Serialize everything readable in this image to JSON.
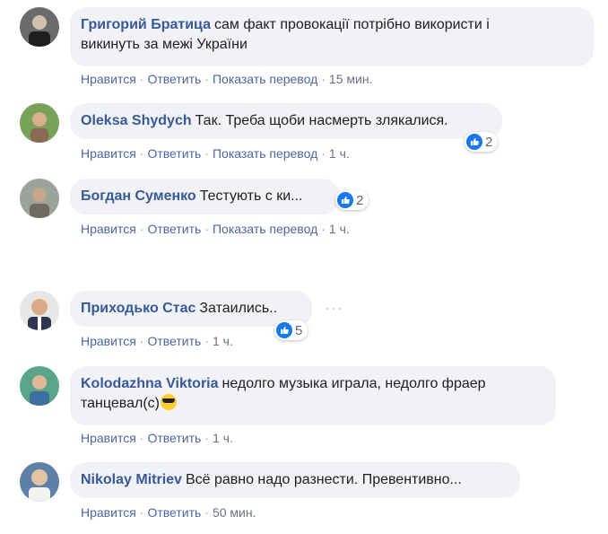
{
  "comments": [
    {
      "author": "Григорий Братица",
      "text": "сам факт провокації потрібно використи і",
      "text_line2": "викинуть за межі України",
      "like": "Нравится",
      "reply": "Ответить",
      "translate": "Показать перевод",
      "time": "15 мин."
    },
    {
      "author": "Oleksa Shydych",
      "text": "Так. Треба щоби насмерть злякалися.",
      "like": "Нравится",
      "reply": "Ответить",
      "translate": "Показать перевод",
      "time": "1 ч.",
      "reactions": "2"
    },
    {
      "author": "Богдан Суменко",
      "text": "Тестують с  ки...",
      "like": "Нравится",
      "reply": "Ответить",
      "translate": "Показать перевод",
      "time": "1 ч.",
      "reactions": "2"
    },
    {
      "author": "Приходько Стас",
      "text": "Затаились..",
      "like": "Нравится",
      "reply": "Ответить",
      "time": "1 ч.",
      "reactions": "5",
      "more": "···"
    },
    {
      "author": "Kolodazhna Viktoria",
      "text": "недолго музыка играла, недолго фраер",
      "text_line2": "танцевал(с)",
      "emoji": "smiling-face-with-sunglasses",
      "like": "Нравится",
      "reply": "Ответить",
      "time": "1 ч."
    },
    {
      "author": "Nikolay Mitriev",
      "text": "Всё равно надо разнести. Превентивно...",
      "like": "Нравится",
      "reply": "Ответить",
      "time": "50 мин."
    }
  ],
  "separator": "·",
  "colors": {
    "author": "#385898",
    "action_link": "#4b67a1",
    "bubble": "#f0f2f5",
    "like_blue": "#1877f2"
  }
}
